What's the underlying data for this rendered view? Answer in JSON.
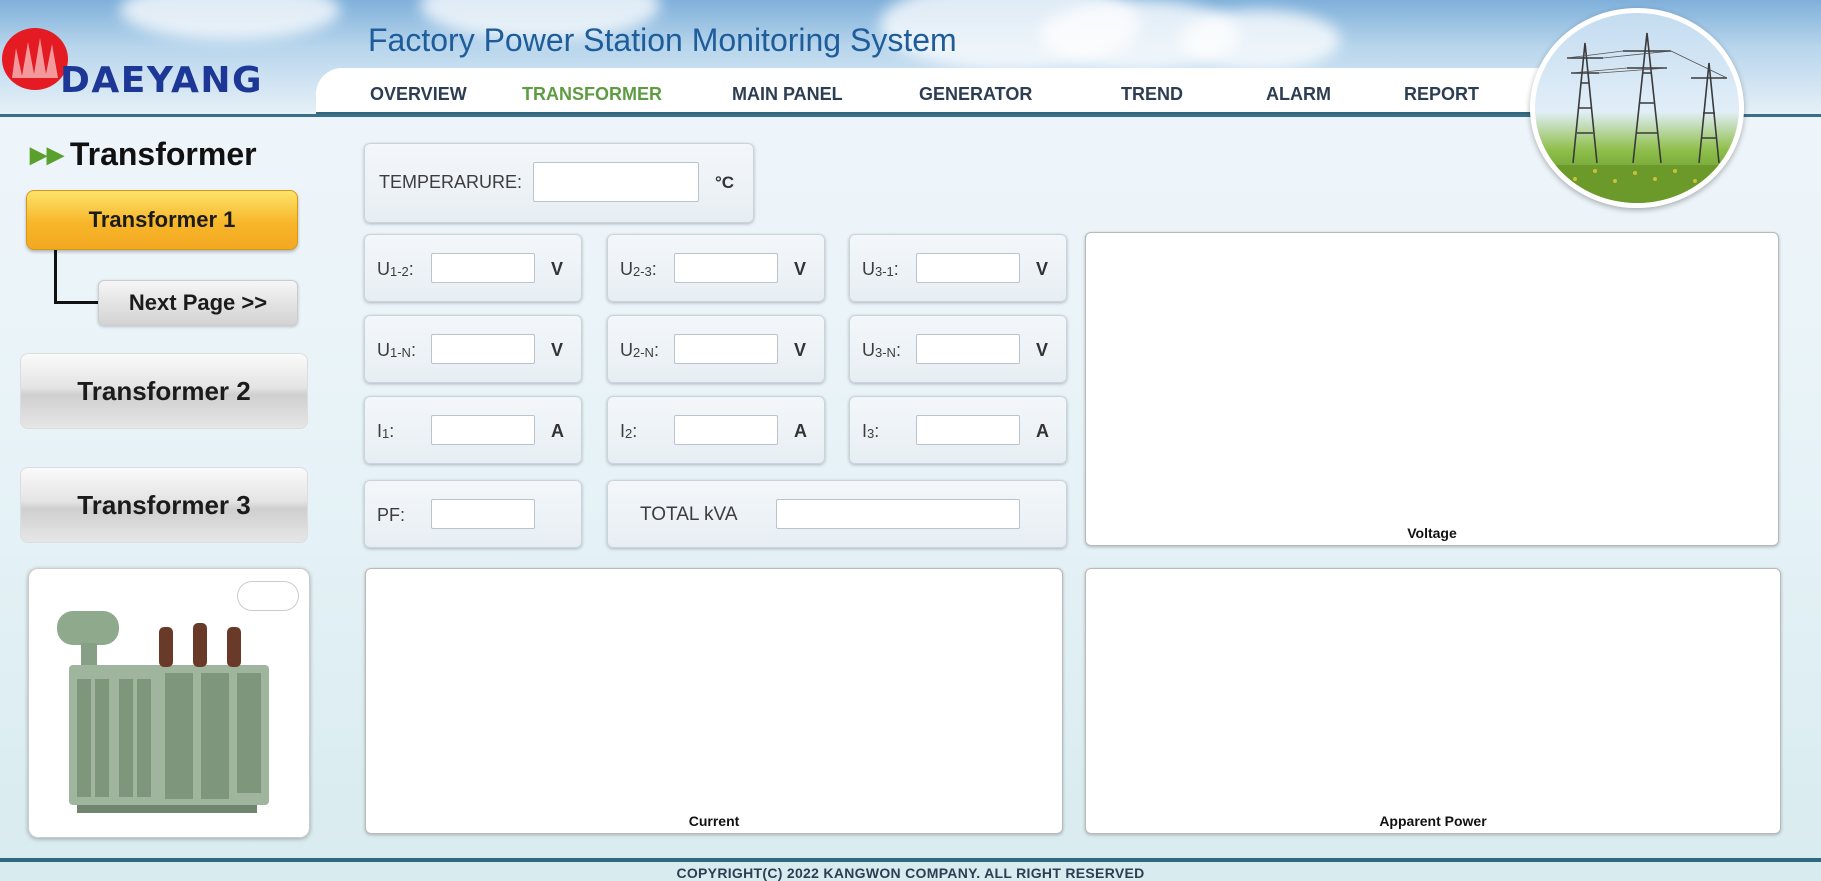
{
  "header": {
    "logo_text": "DAEYANG",
    "title": "Factory Power Station Monitoring System"
  },
  "nav": {
    "items": [
      {
        "label": "OVERVIEW"
      },
      {
        "label": "TRANSFORMER"
      },
      {
        "label": "MAIN PANEL"
      },
      {
        "label": "GENERATOR"
      },
      {
        "label": "TREND"
      },
      {
        "label": "ALARM"
      },
      {
        "label": "REPORT"
      }
    ],
    "active": "TRANSFORMER"
  },
  "sidebar": {
    "title": "Transformer",
    "transformer1": "Transformer 1",
    "next_page": "Next Page >>",
    "transformer2": "Transformer 2",
    "transformer3": "Transformer 3"
  },
  "readings": {
    "temperature": {
      "label": "TEMPERARURE:",
      "unit": "°C",
      "value": ""
    },
    "u12": {
      "label_main": "U",
      "label_sub": "1-2",
      "suffix": ":",
      "unit": "V",
      "value": ""
    },
    "u23": {
      "label_main": "U",
      "label_sub": "2-3",
      "suffix": ":",
      "unit": "V",
      "value": ""
    },
    "u31": {
      "label_main": "U",
      "label_sub": "3-1",
      "suffix": ":",
      "unit": "V",
      "value": ""
    },
    "u1n": {
      "label_main": "U",
      "label_sub": "1-N",
      "suffix": ":",
      "unit": "V",
      "value": ""
    },
    "u2n": {
      "label_main": "U",
      "label_sub": "2-N",
      "suffix": ":",
      "unit": "V",
      "value": ""
    },
    "u3n": {
      "label_main": "U",
      "label_sub": "3-N",
      "suffix": ":",
      "unit": "V",
      "value": ""
    },
    "i1": {
      "label_main": "I",
      "label_sub": "1",
      "suffix": ":",
      "unit": "A",
      "value": ""
    },
    "i2": {
      "label_main": "I",
      "label_sub": "2",
      "suffix": ":",
      "unit": "A",
      "value": ""
    },
    "i3": {
      "label_main": "I",
      "label_sub": "3",
      "suffix": ":",
      "unit": "A",
      "value": ""
    },
    "pf": {
      "label": "PF:",
      "value": ""
    },
    "total_kva": {
      "label": "TOTAL kVA",
      "value": ""
    }
  },
  "charts": {
    "voltage": "Voltage",
    "current": "Current",
    "apparent_power": "Apparent Power"
  },
  "footer": {
    "copyright": "COPYRIGHT(C) 2022 KANGWON COMPANY. ALL RIGHT RESERVED"
  },
  "colors": {
    "nav_active": "#5e9c43",
    "accent_yellow": "#f7b62a",
    "brand_red": "#e41b23",
    "brand_blue": "#1d3796"
  }
}
